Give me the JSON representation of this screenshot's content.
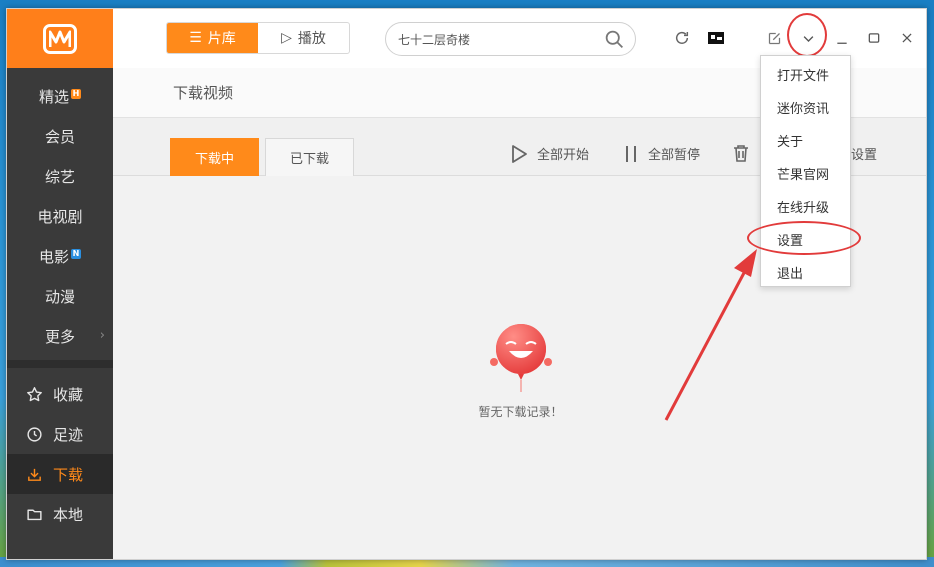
{
  "sidebar": {
    "nav": [
      {
        "label": "精选",
        "badge": "H"
      },
      {
        "label": "会员"
      },
      {
        "label": "综艺"
      },
      {
        "label": "电视剧"
      },
      {
        "label": "电影",
        "badge": "N"
      },
      {
        "label": "动漫"
      },
      {
        "label": "更多",
        "chevron": "›"
      }
    ],
    "nav2": [
      {
        "label": "收藏",
        "icon": "star-icon"
      },
      {
        "label": "足迹",
        "icon": "clock-icon"
      },
      {
        "label": "下载",
        "icon": "download-icon",
        "active": true
      },
      {
        "label": "本地",
        "icon": "folder-icon"
      }
    ]
  },
  "header": {
    "seg": [
      {
        "label": "片库",
        "icon": "☰"
      },
      {
        "label": "播放",
        "icon": "▷"
      }
    ],
    "search_value": "七十二层奇楼"
  },
  "subheader": {
    "title": "下载视频"
  },
  "tabs": {
    "downloading": "下载中",
    "downloaded": "已下载",
    "start_all": "全部开始",
    "pause_all": "全部暂停",
    "settings_partial": "设置"
  },
  "empty": {
    "text": "暂无下载记录！"
  },
  "menu": {
    "items": [
      "打开文件",
      "迷你资讯",
      "关于",
      "芒果官网",
      "在线升级",
      "设置",
      "退出"
    ]
  },
  "colors": {
    "accent": "#ff8a1a",
    "annotation": "#e23b3b",
    "sidebar": "#3a3a3a"
  }
}
